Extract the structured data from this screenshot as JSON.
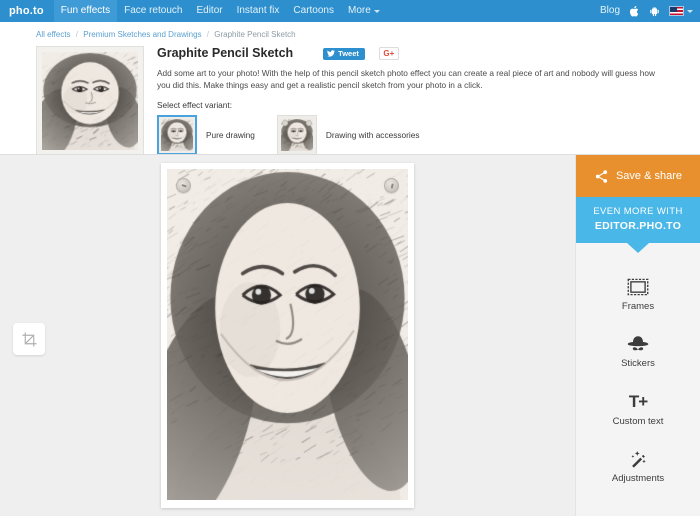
{
  "nav": {
    "logo": "pho.to",
    "items": [
      {
        "label": "Fun effects",
        "active": true
      },
      {
        "label": "Face retouch",
        "active": false
      },
      {
        "label": "Editor",
        "active": false
      },
      {
        "label": "Instant fix",
        "active": false
      },
      {
        "label": "Cartoons",
        "active": false
      },
      {
        "label": "More",
        "active": false,
        "has_caret": true
      }
    ],
    "right": {
      "blog_label": "Blog",
      "apple_icon": "apple-icon",
      "android_icon": "android-icon",
      "language_flag": "us-flag-icon"
    }
  },
  "breadcrumb": {
    "items": [
      "All effects",
      "Premium Sketches and Drawings",
      "Graphite Pencil Sketch"
    ],
    "separator": "/"
  },
  "effect": {
    "title": "Graphite Pencil Sketch",
    "description": "Add some art to your photo! With the help of this pencil sketch photo effect you can create a real piece of art and nobody will guess how you did this. Make things easy and get a realistic pencil sketch from your photo in a click.",
    "preview_alt": "pencil-sketch-portrait-preview"
  },
  "social": {
    "tweet_label": "Tweet",
    "tweet_icon": "twitter-bird-icon",
    "gplus_label": "G+"
  },
  "variants": {
    "label": "Select effect variant:",
    "options": [
      {
        "name": "Pure drawing",
        "selected": true
      },
      {
        "name": "Drawing with accessories",
        "selected": false
      }
    ]
  },
  "workspace": {
    "crop_tool": "crop-icon",
    "photo_alt": "pencil-sketch-portrait-large",
    "pins": [
      "pin-left",
      "pin-right"
    ]
  },
  "sidebar": {
    "save_share_label": "Save & share",
    "save_share_icon": "share-icon",
    "promo_line1": "EVEN MORE WITH",
    "promo_line2": "EDITOR.PHO.TO",
    "tools": [
      {
        "label": "Frames",
        "icon": "frame-icon"
      },
      {
        "label": "Stickers",
        "icon": "hat-mustache-icon"
      },
      {
        "label": "Custom text",
        "icon": "text-plus-icon"
      },
      {
        "label": "Adjustments",
        "icon": "magic-wand-icon"
      }
    ]
  },
  "colors": {
    "nav_blue": "#2d8fcd",
    "accent_orange": "#e8902e",
    "promo_blue": "#49b7e8",
    "selected_border": "#4aa3df",
    "workspace_gray": "#efefef"
  }
}
